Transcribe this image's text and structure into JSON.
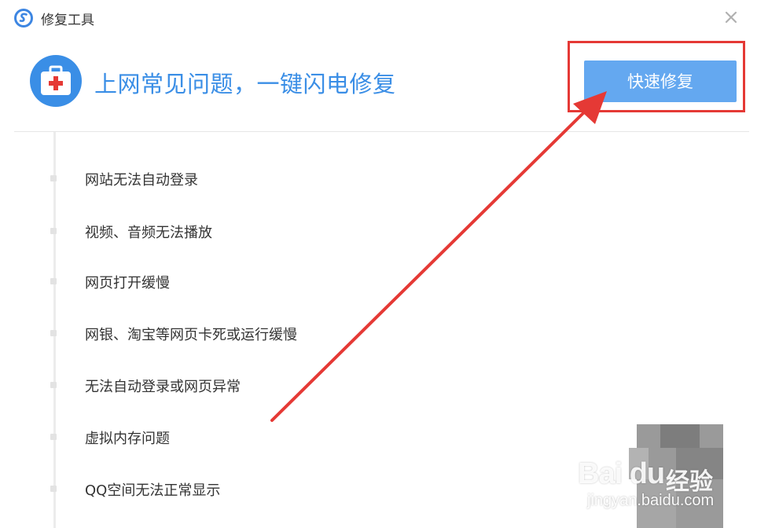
{
  "window": {
    "title": "修复工具",
    "logo_icon": "sogou-browser-logo-icon",
    "close_icon": "close-icon"
  },
  "banner": {
    "icon": "first-aid-kit-icon",
    "headline": "上网常见问题，一键闪电修复",
    "fix_button_label": "快速修复",
    "accent": "#3a8ee6",
    "button_color": "#64a8f0"
  },
  "issues": [
    "网站无法自动登录",
    "视频、音频无法播放",
    "网页打开缓慢",
    "网银、淘宝等网页卡死或运行缓慢",
    "无法自动登录或网页异常",
    "虚拟内存问题",
    "QQ空间无法正常显示"
  ],
  "annotation": {
    "color": "#e53935"
  },
  "watermark": {
    "brand": "Bai du",
    "product": "经验",
    "url": "jingyan.baidu.com"
  }
}
